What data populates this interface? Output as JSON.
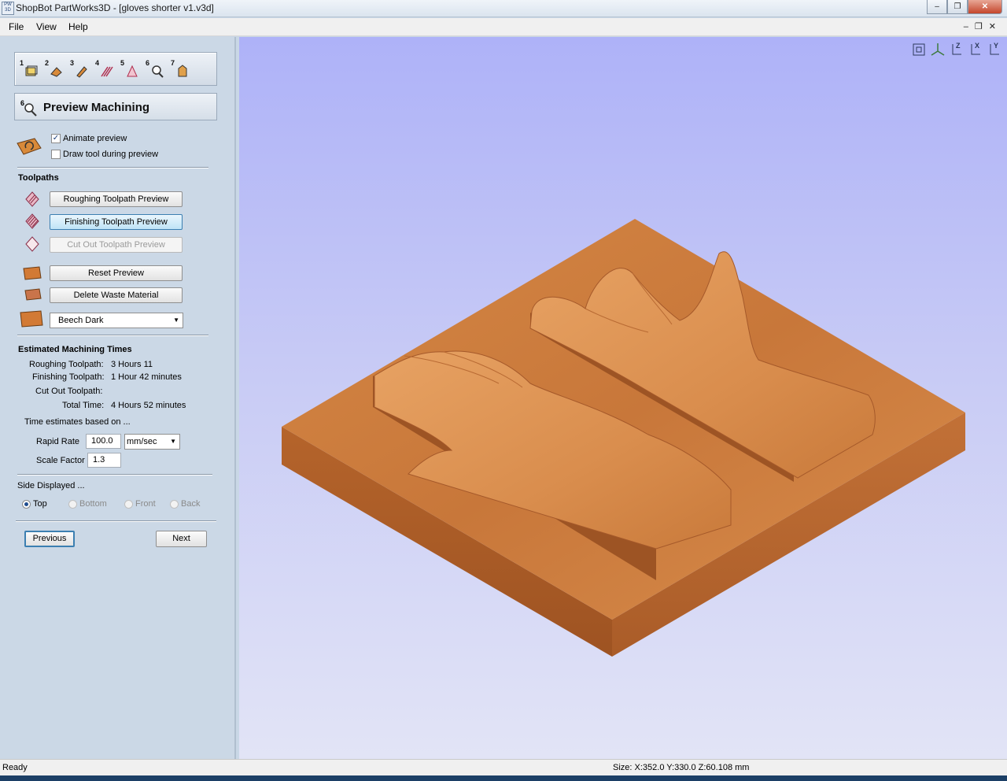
{
  "window": {
    "app_icon": "PW 3D",
    "title": "ShopBot PartWorks3D - [gloves shorter v1.v3d]",
    "buttons": [
      "minimize-icon",
      "maximize-icon",
      "close-icon"
    ]
  },
  "menu": {
    "items": [
      "File",
      "View",
      "Help"
    ]
  },
  "steps": [
    "1",
    "2",
    "3",
    "4",
    "5",
    "6",
    "7"
  ],
  "stage": {
    "number": "6",
    "title": "Preview Machining"
  },
  "options": {
    "animate_preview": {
      "label": "Animate preview",
      "checked": true
    },
    "draw_tool": {
      "label": "Draw tool during preview",
      "checked": false
    }
  },
  "toolpaths": {
    "heading": "Toolpaths",
    "roughing": "Roughing Toolpath Preview",
    "finishing": "Finishing Toolpath Preview",
    "cutout": "Cut Out Toolpath Preview",
    "reset": "Reset Preview",
    "delete_waste": "Delete Waste Material",
    "material": "Beech Dark"
  },
  "times": {
    "heading": "Estimated Machining Times",
    "roughing_label": "Roughing Toolpath:",
    "roughing_value": "3 Hours 11",
    "finishing_label": "Finishing Toolpath:",
    "finishing_value": "1 Hour 42 minutes",
    "cutout_label": "Cut Out Toolpath:",
    "cutout_value": "",
    "total_label": "Total Time:",
    "total_value": "4 Hours 52 minutes",
    "based_on": "Time estimates based on ...",
    "rapid_label": "Rapid Rate",
    "rapid_value": "100.0",
    "rapid_unit": "mm/sec",
    "scale_label": "Scale Factor",
    "scale_value": "1.3"
  },
  "side": {
    "heading": "Side Displayed ...",
    "options": [
      "Top",
      "Bottom",
      "Front",
      "Back"
    ],
    "selected": "Top"
  },
  "nav": {
    "previous": "Previous",
    "next": "Next"
  },
  "view_tools": [
    "zoom-extents-icon",
    "iso-view-icon",
    "z-view-icon",
    "x-view-icon",
    "y-view-icon"
  ],
  "view_tool_labels": [
    "",
    "",
    "Z",
    "X",
    "Y"
  ],
  "status": {
    "left": "Ready",
    "size": "Size: X:352.0 Y:330.0 Z:60.108 mm"
  },
  "colors": {
    "panel_bg": "#cbd8e6",
    "viewport_top": "#aeb2f8",
    "viewport_bottom": "#e2e4f6",
    "wood": "#c8773a"
  }
}
